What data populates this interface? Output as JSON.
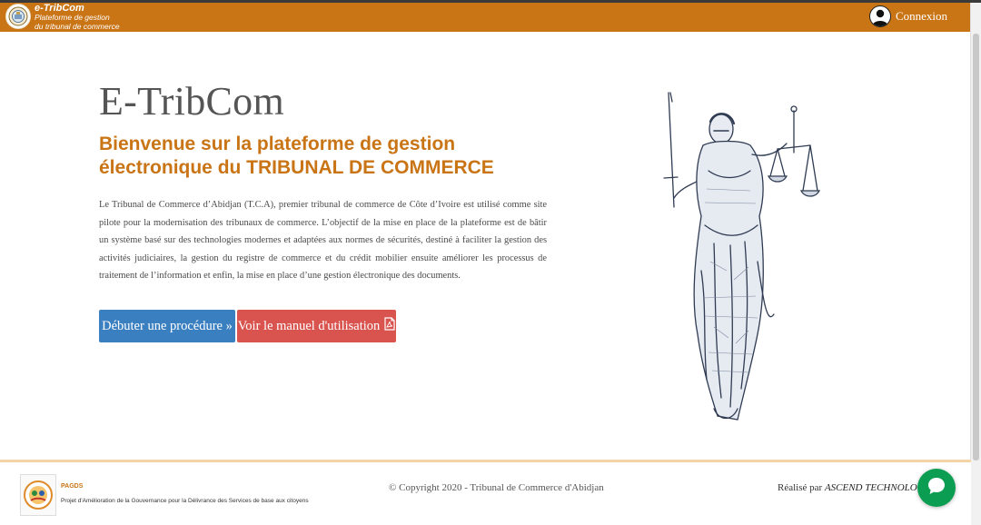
{
  "brand": {
    "name": "e-TribCom",
    "subtitle_line1": "Plateforme de gestion",
    "subtitle_line2": "du tribunal de commerce"
  },
  "header": {
    "login_label": "Connexion"
  },
  "hero": {
    "title": "E-TribCom",
    "welcome": "Bienvenue sur la plateforme de gestion électronique du TRIBUNAL DE COMMERCE",
    "intro": "Le Tribunal de Commerce d’Abidjan (T.C.A), premier tribunal de commerce de Côte d’Ivoire est utilisé comme site pilote pour la modernisation des tribunaux de commerce. L’objectif de la mise en place de la plateforme est de bâtir un système basé sur des technologies modernes et adaptées aux normes de sécurités, destiné à faciliter la gestion des activités judiciaires, la gestion du registre de commerce et du crédit mobilier ensuite améliorer les processus de traitement de l’information et enfin, la mise en place d’une gestion électronique des documents.",
    "start_button": "Débuter une procédure »",
    "manual_button": "Voir le manuel d'utilisation"
  },
  "footer": {
    "pagds_title": "PAGDS",
    "pagds_desc": "Projet d'Amélioration de la Gouvernance pour la Délivrance des Services de base aux citoyens",
    "copyright": "© Copyright 2020 - Tribunal de Commerce d'Abidjan",
    "realise_prefix": "Réalisé par",
    "realise_company": "ASCEND TECHNOLOGY"
  },
  "icons": {
    "brand_logo": "court-seal-icon",
    "login": "user-avatar-icon",
    "pdf": "pdf-file-icon",
    "chat": "chat-bubble-icon",
    "illustration": "lady-justice-illustration"
  },
  "colors": {
    "navbar": "#c97415",
    "accent_text": "#c97415",
    "start_button": "#3a7fc0",
    "manual_button": "#d9534f",
    "footer_line": "#f3d4a6",
    "chat": "#0b9e52"
  }
}
